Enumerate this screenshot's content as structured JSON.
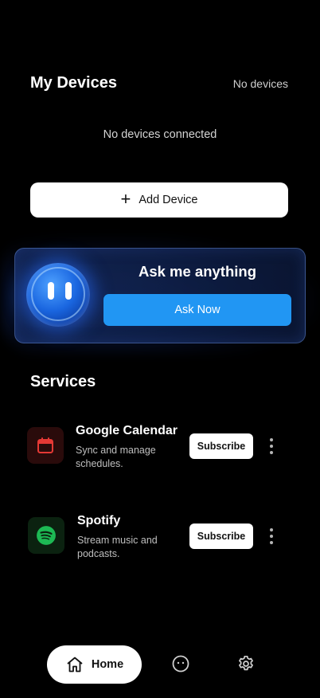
{
  "devices": {
    "title": "My Devices",
    "status": "No devices",
    "empty_message": "No devices connected",
    "add_button_label": "Add Device"
  },
  "assistant": {
    "title": "Ask me anything",
    "button_label": "Ask Now"
  },
  "services": {
    "title": "Services",
    "items": [
      {
        "name": "Google Calendar",
        "description": "Sync and manage schedules.",
        "action_label": "Subscribe",
        "icon": "calendar-icon",
        "accent": "#e53935"
      },
      {
        "name": "Spotify",
        "description": "Stream music and podcasts.",
        "action_label": "Subscribe",
        "icon": "spotify-icon",
        "accent": "#1db954"
      }
    ]
  },
  "bottom_nav": {
    "items": [
      {
        "label": "Home",
        "icon": "home-icon",
        "active": true
      },
      {
        "label": "",
        "icon": "assistant-face-icon",
        "active": false
      },
      {
        "label": "",
        "icon": "gear-icon",
        "active": false
      }
    ]
  },
  "colors": {
    "background": "#000000",
    "primary_blue": "#2196f3"
  }
}
